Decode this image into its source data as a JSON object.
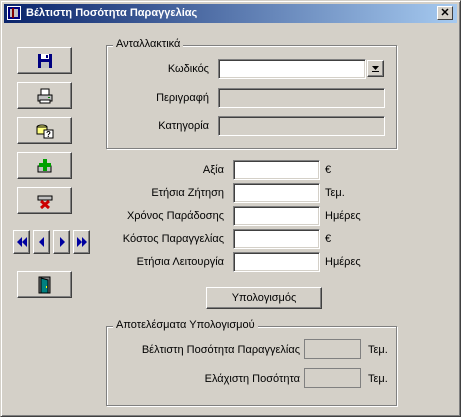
{
  "window": {
    "title": "Βέλτιστη Ποσότητα Παραγγελίας",
    "close_label": "✕"
  },
  "toolbar": {
    "buttons": [
      {
        "name": "save",
        "icon": "floppy-disk-icon"
      },
      {
        "name": "print",
        "icon": "printer-icon"
      },
      {
        "name": "search",
        "icon": "search-query-icon"
      },
      {
        "name": "add",
        "icon": "plus-icon"
      },
      {
        "name": "delete",
        "icon": "delete-x-icon"
      },
      {
        "name": "exit",
        "icon": "exit-door-icon"
      }
    ],
    "nav": [
      "first",
      "previous",
      "next",
      "last"
    ]
  },
  "parts": {
    "legend": "Ανταλλακτικά",
    "code_label": "Κωδικός",
    "code_value": "",
    "description_label": "Περιγραφή",
    "description_value": "",
    "category_label": "Κατηγορία",
    "category_value": ""
  },
  "inputs": {
    "value_label": "Αξία",
    "value_unit": "€",
    "annual_demand_label": "Ετήσια Ζήτηση",
    "annual_demand_unit": "Τεμ.",
    "delivery_time_label": "Χρόνος Παράδοσης",
    "delivery_time_unit": "Ημέρες",
    "order_cost_label": "Κόστος Παραγγελίας",
    "order_cost_unit": "€",
    "annual_operation_label": "Ετήσια Λειτουργία",
    "annual_operation_unit": "Ημέρες"
  },
  "calculate_label": "Υπολογισμός",
  "results": {
    "legend": "Αποτελέσματα Υπολογισμού",
    "eoq_label": "Βέλτιστη Ποσότητα Παραγγελίας",
    "eoq_unit": "Τεμ.",
    "min_label": "Ελάχιστη Ποσότητα",
    "min_unit": "Τεμ."
  },
  "colors": {
    "titlebar_start": "#0a246a",
    "titlebar_end": "#a6caf0",
    "face": "#d4d0c8"
  }
}
